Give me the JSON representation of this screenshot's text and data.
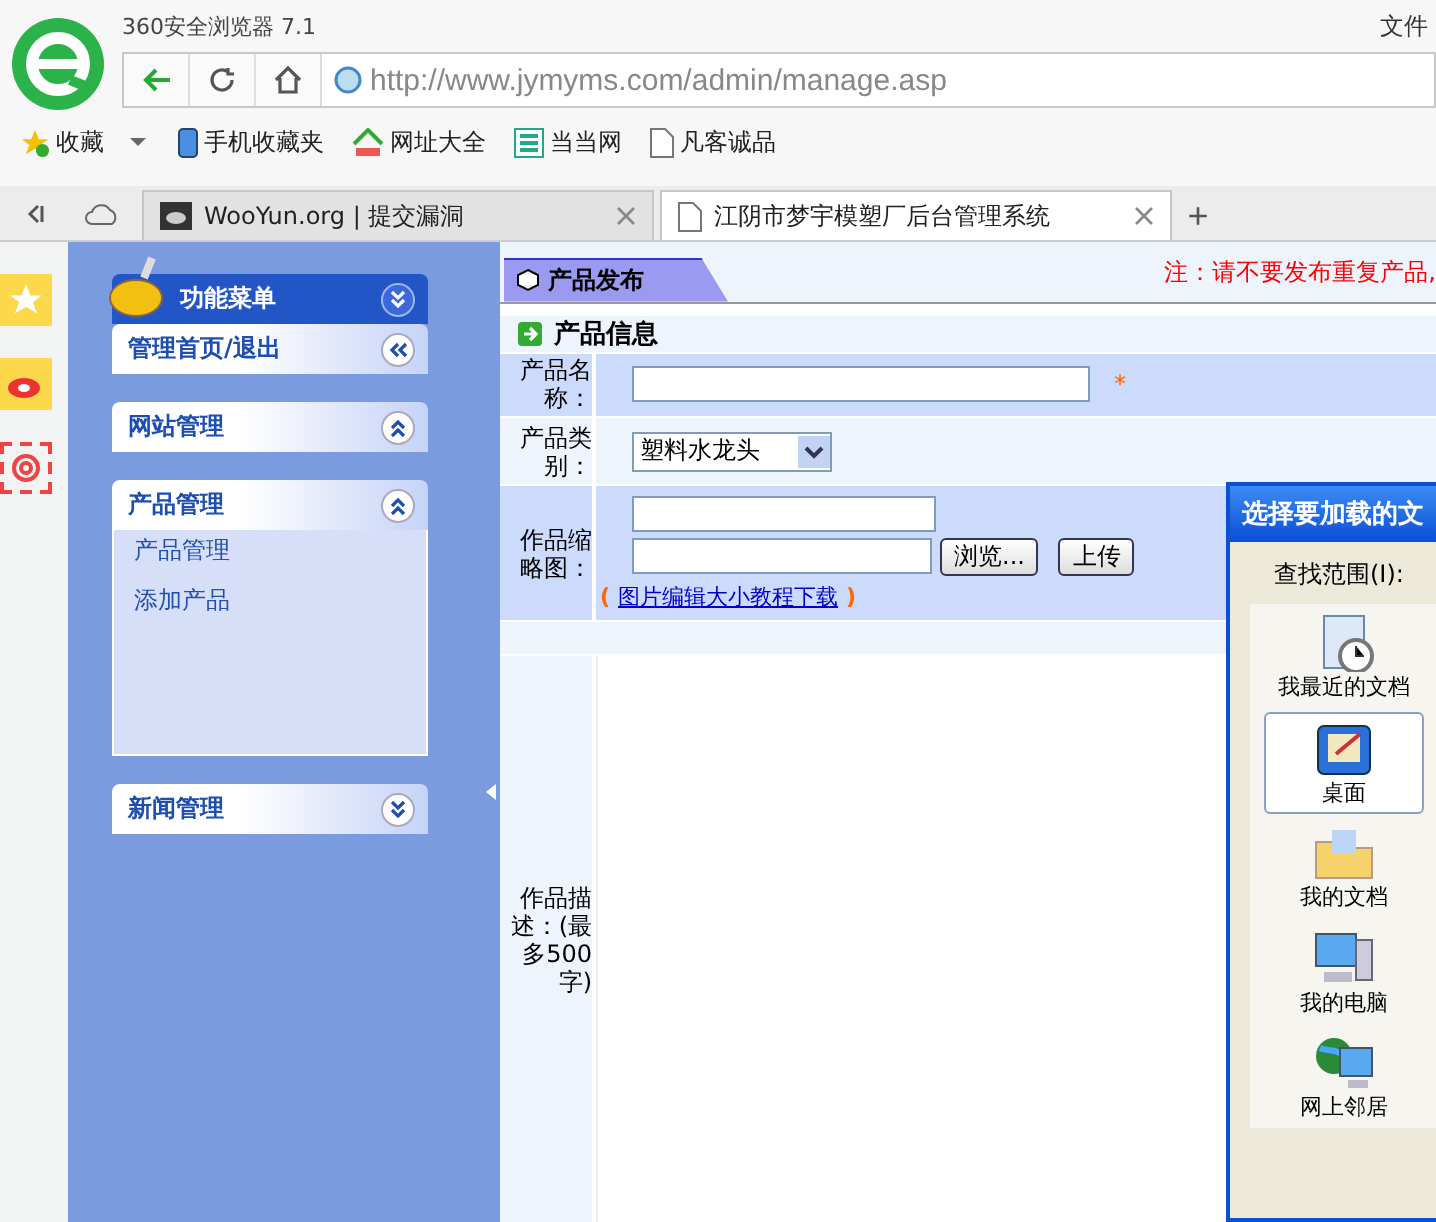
{
  "browser": {
    "app_title": "360安全浏览器 7.1",
    "menu": "文件",
    "url": "http://www.jymyms.com/admin/manage.asp",
    "bookmarks": [
      {
        "kind": "star",
        "label": "收藏",
        "dropdown": true
      },
      {
        "kind": "phone",
        "label": "手机收藏夹",
        "dropdown": false
      },
      {
        "kind": "house",
        "label": "网址大全",
        "dropdown": false
      },
      {
        "kind": "grid",
        "label": "当当网",
        "dropdown": false
      },
      {
        "kind": "page",
        "label": "凡客诚品",
        "dropdown": false
      }
    ],
    "tabs": [
      {
        "kind": "site",
        "label": "WooYun.org | 提交漏洞",
        "selected": false
      },
      {
        "kind": "page",
        "label": "江阴市梦宇模塑厂后台管理系统",
        "selected": true
      }
    ],
    "new_tab": "+"
  },
  "sidebar": {
    "title": "功能菜单",
    "sections": [
      {
        "title": "管理首页/退出",
        "kind": "left"
      },
      {
        "title": "网站管理",
        "kind": "up"
      },
      {
        "title": "产品管理",
        "kind": "up",
        "items": [
          "产品管理",
          "添加产品"
        ]
      },
      {
        "title": "新闻管理",
        "kind": "down"
      }
    ]
  },
  "content": {
    "tab": "产品发布",
    "note": "注：请不要发布重复产品,",
    "section_title": "产品信息",
    "rows": [
      {
        "kind": "text",
        "label": "产品名称：",
        "required_mark": "*"
      },
      {
        "kind": "select",
        "label": "产品类别：",
        "value": "塑料水龙头"
      },
      {
        "kind": "thumbnail",
        "label": "作品缩略图：",
        "browse": "浏览...",
        "upload": "上传",
        "link": "图片编辑大小教程下载",
        "link_open": "(",
        "link_close": ")"
      },
      {
        "kind": "textarea",
        "label": "作品描述：(最多500字)"
      }
    ]
  },
  "dialog": {
    "title": "选择要加载的文",
    "look_in": "查找范围(I):",
    "places": [
      {
        "kind": "recent",
        "label": "我最近的文档",
        "selected": false
      },
      {
        "kind": "desktop",
        "label": "桌面",
        "selected": true
      },
      {
        "kind": "documents",
        "label": "我的文档",
        "selected": false
      },
      {
        "kind": "computer",
        "label": "我的电脑",
        "selected": false
      },
      {
        "kind": "network",
        "label": "网上邻居",
        "selected": false
      }
    ]
  }
}
